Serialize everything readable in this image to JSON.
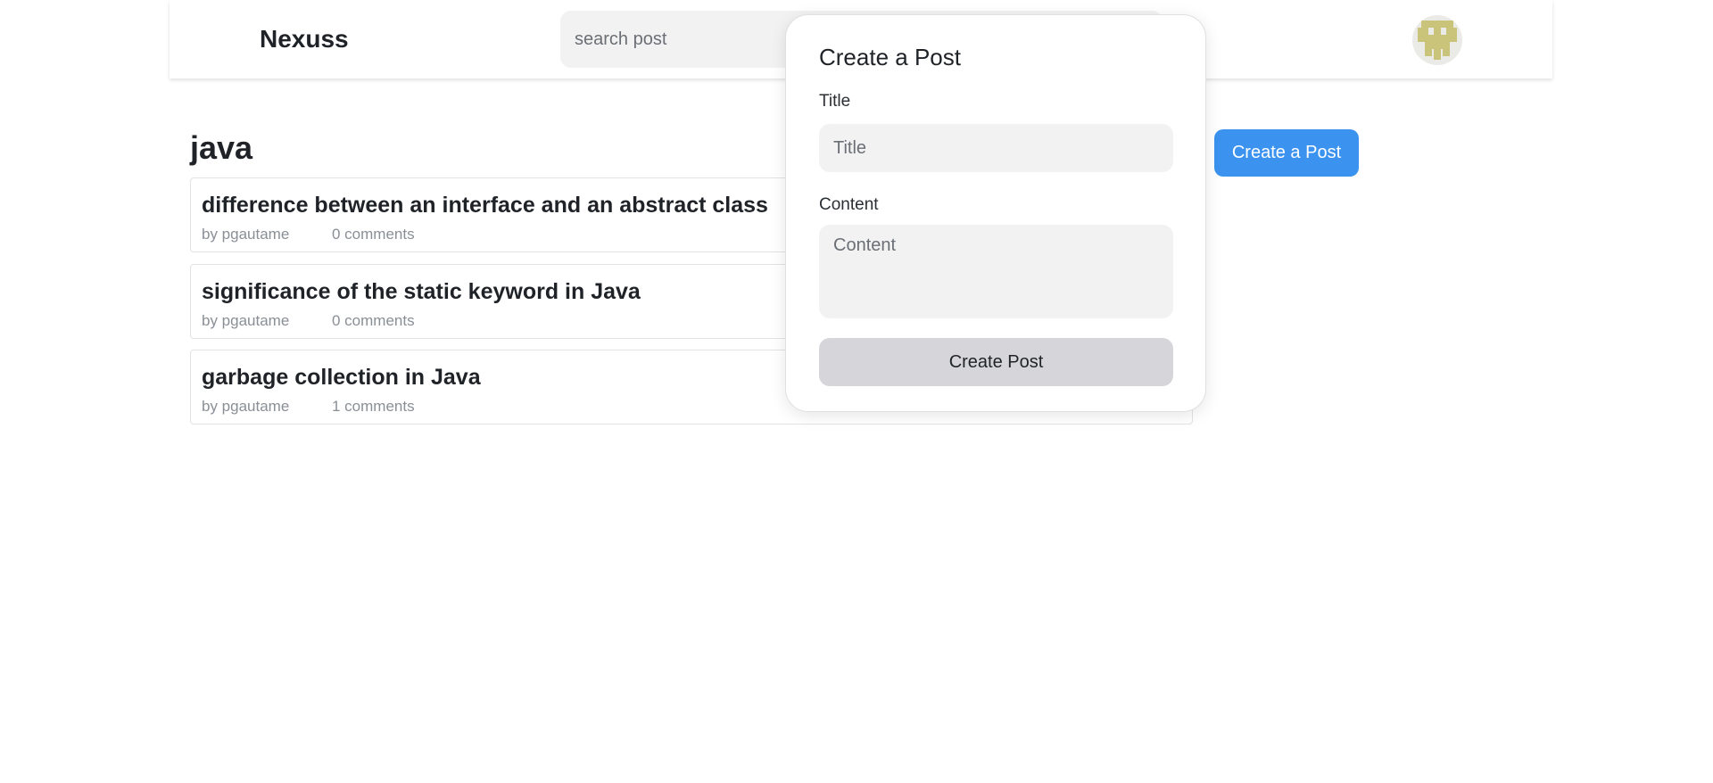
{
  "navbar": {
    "brand": "Nexuss",
    "search_placeholder": "search post",
    "avatar_icon": "pixel-avatar-icon",
    "avatar_color": "#c9c47a"
  },
  "main": {
    "section_title": "java",
    "create_button_label": "Create a Post",
    "posts": [
      {
        "title": "difference between an interface and an abstract class",
        "author": "by pgautame",
        "comments": "0 comments"
      },
      {
        "title": "significance of the static keyword in Java",
        "author": "by pgautame",
        "comments": "0 comments"
      },
      {
        "title": "garbage collection in Java",
        "author": "by pgautame",
        "comments": "1 comments"
      }
    ]
  },
  "modal": {
    "title": "Create a Post",
    "title_label": "Title",
    "title_placeholder": "Title",
    "content_label": "Content",
    "content_placeholder": "Content",
    "submit_label": "Create Post"
  },
  "colors": {
    "accent": "#3b93ef",
    "submit_bg": "#d6d6da",
    "input_bg": "#f2f2f2"
  }
}
